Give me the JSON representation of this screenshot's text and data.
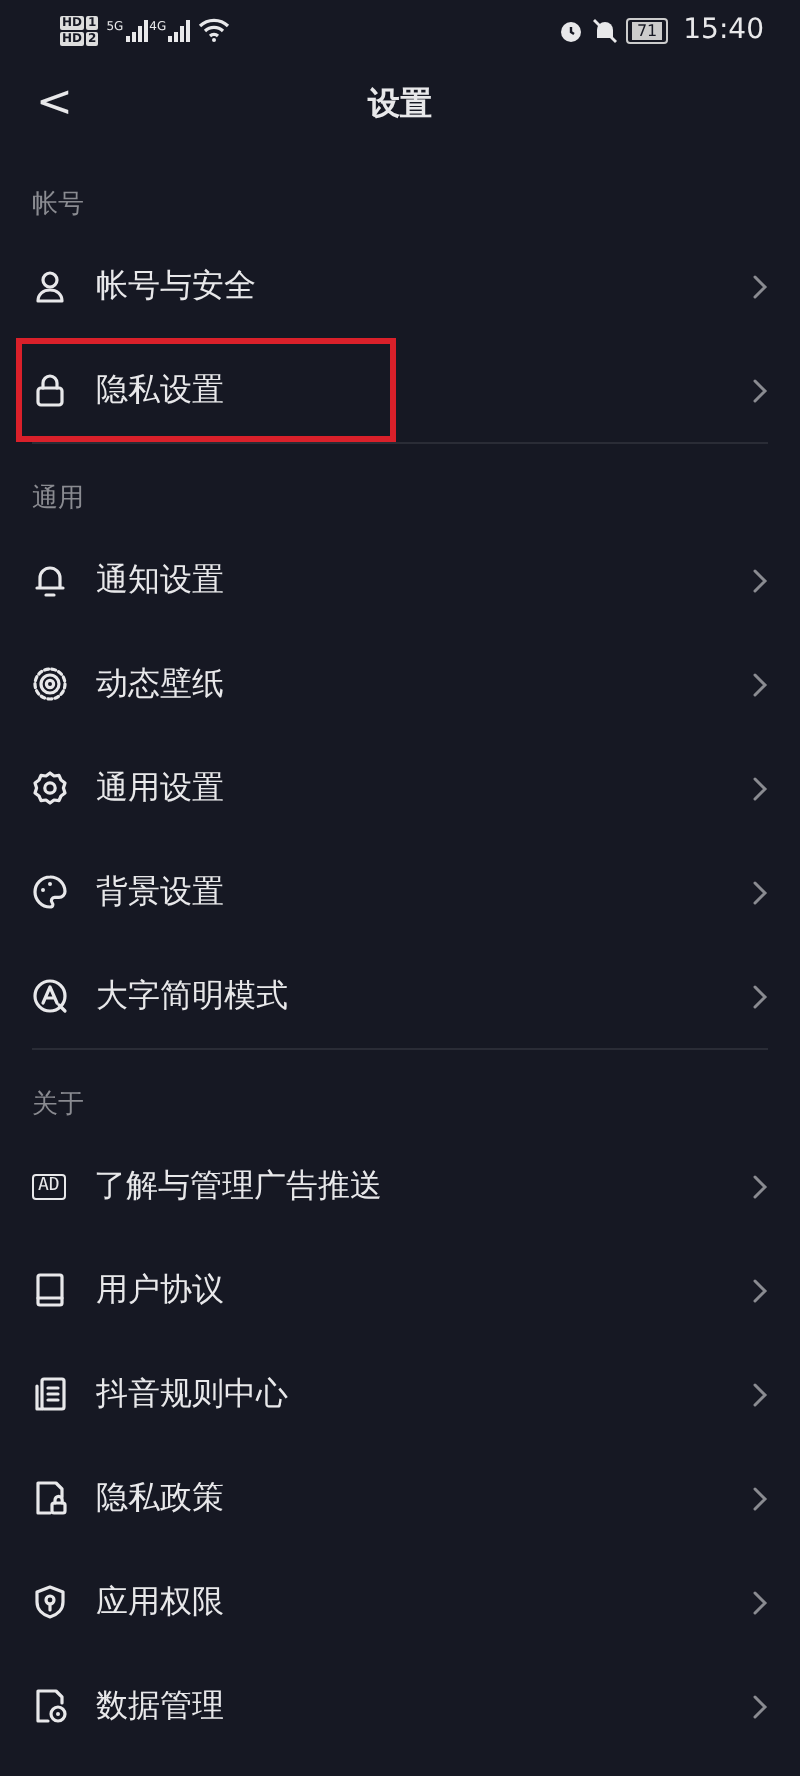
{
  "status_bar": {
    "sim_badges": [
      "HD",
      "HD"
    ],
    "sim_numbers": [
      "1",
      "2"
    ],
    "networks": [
      "5G",
      "4G"
    ],
    "battery": "71",
    "time": "15:40"
  },
  "header": {
    "back": "<",
    "title": "设置"
  },
  "sections": [
    {
      "title": "帐号",
      "items": [
        {
          "kind": "person",
          "label": "帐号与安全",
          "highlighted": false
        },
        {
          "kind": "lock",
          "label": "隐私设置",
          "highlighted": true
        }
      ]
    },
    {
      "title": "通用",
      "items": [
        {
          "kind": "bell",
          "label": "通知设置",
          "highlighted": false
        },
        {
          "kind": "wallpaper",
          "label": "动态壁纸",
          "highlighted": false
        },
        {
          "kind": "gear",
          "label": "通用设置",
          "highlighted": false
        },
        {
          "kind": "palette",
          "label": "背景设置",
          "highlighted": false
        },
        {
          "kind": "font",
          "label": "大字简明模式",
          "highlighted": false
        }
      ]
    },
    {
      "title": "关于",
      "items": [
        {
          "kind": "ad",
          "icon_text": "AD",
          "label": "了解与管理广告推送",
          "highlighted": false
        },
        {
          "kind": "book",
          "label": "用户协议",
          "highlighted": false
        },
        {
          "kind": "rules",
          "label": "抖音规则中心",
          "highlighted": false
        },
        {
          "kind": "privacy",
          "label": "隐私政策",
          "highlighted": false
        },
        {
          "kind": "shield",
          "label": "应用权限",
          "highlighted": false
        },
        {
          "kind": "data",
          "label": "数据管理",
          "highlighted": false
        }
      ]
    }
  ]
}
